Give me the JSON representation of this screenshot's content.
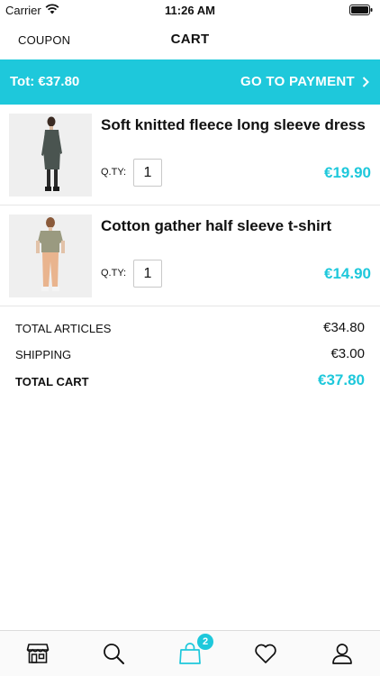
{
  "status_bar": {
    "carrier": "Carrier",
    "time": "11:26 AM"
  },
  "nav": {
    "coupon_label": "COUPON",
    "title": "CART"
  },
  "total_bar": {
    "total_label": "Tot: €37.80",
    "payment_label": "GO TO PAYMENT"
  },
  "items": [
    {
      "name": "Soft knitted fleece long sleeve dress",
      "qty_label": "Q.TY:",
      "qty": "1",
      "price": "€19.90"
    },
    {
      "name": "Cotton gather half sleeve t-shirt",
      "qty_label": "Q.TY:",
      "qty": "1",
      "price": "€14.90"
    }
  ],
  "summary": {
    "articles_label": "TOTAL ARTICLES",
    "articles_value": "€34.80",
    "shipping_label": "SHIPPING",
    "shipping_value": "€3.00",
    "total_label": "TOTAL CART",
    "total_value": "€37.80"
  },
  "tab_bar": {
    "tabs": [
      {
        "icon": "store-icon"
      },
      {
        "icon": "search-icon"
      },
      {
        "icon": "shopping-bag-icon",
        "badge": "2"
      },
      {
        "icon": "heart-icon"
      },
      {
        "icon": "user-icon"
      }
    ]
  },
  "colors": {
    "accent": "#1ec8db",
    "text": "#111111"
  }
}
